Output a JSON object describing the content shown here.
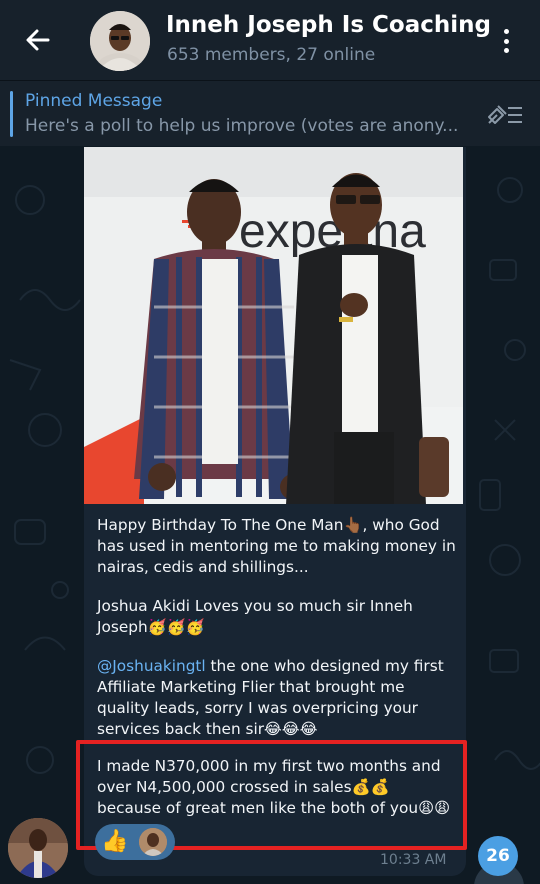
{
  "header": {
    "title": "Inneh Joseph Is Coaching",
    "subtitle": "653 members, 27 online"
  },
  "pinned": {
    "title": "Pinned Message",
    "text": "Here's a poll to help us improve (votes are anony..."
  },
  "photo": {
    "banner_text": "expertna"
  },
  "message": {
    "p1": "Happy Birthday To The One Man👆🏾, who God has used in mentoring me to making money in nairas, cedis and shillings...",
    "p2": "Joshua Akidi Loves you so much sir Inneh Joseph🥳🥳🥳",
    "p3_mention": "@Joshuakingtl",
    "p3_rest": " the one who designed my first Affiliate Marketing Flier that brought me quality leads, sorry I was overpricing your services back then sir😂😂😂",
    "p4": "I made N370,000 in my first two months and over N4,500,000 crossed in sales💰💰 because of great men like the both of you😩😩",
    "time": "10:33 AM"
  },
  "reaction": {
    "emoji": "👍"
  },
  "unread_count": "26",
  "colors": {
    "header_bg": "#17212b",
    "accent": "#5ea5e6",
    "bubble_bg": "#182533",
    "highlight": "#e52222",
    "badge": "#4b9fe3"
  }
}
